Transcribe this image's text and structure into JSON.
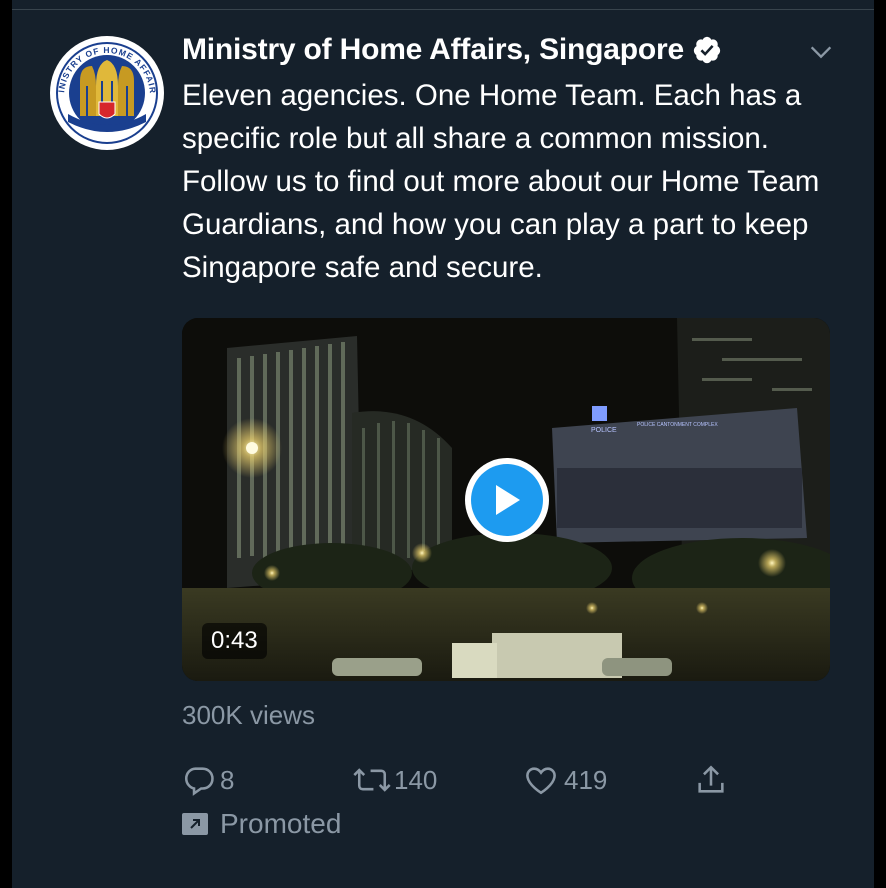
{
  "tweet": {
    "author_name": "Ministry of Home Affairs, Singapore",
    "verified": true,
    "text": "Eleven agencies. One Home Team. Each has a specific role but all share a common mission. Follow us to find out more about our Home Team Guardians, and how you can play a part to keep Singapore safe and secure.",
    "avatar": {
      "logo_text": "MINISTRY OF HOME AFFAIRS"
    },
    "media": {
      "type": "video",
      "duration": "0:43",
      "scene_sign_top": "POLICE",
      "scene_sign_banner": "POLICE CANTONMENT COMPLEX"
    },
    "views": "300K views",
    "stats": {
      "replies": "8",
      "retweets": "140",
      "likes": "419"
    },
    "promoted_label": "Promoted"
  },
  "colors": {
    "background": "#15202b",
    "text_primary": "#ffffff",
    "text_secondary": "#8b98a5",
    "accent": "#1d9bf0",
    "avatar_ring": "#1a3f8f",
    "avatar_gold": "#c79a22",
    "avatar_red": "#d6262b"
  },
  "icons": {
    "reply": "reply-icon",
    "retweet": "retweet-icon",
    "like": "heart-icon",
    "share": "share-icon",
    "verified": "verified-badge-icon",
    "more": "chevron-down-icon",
    "promoted": "promoted-icon"
  }
}
